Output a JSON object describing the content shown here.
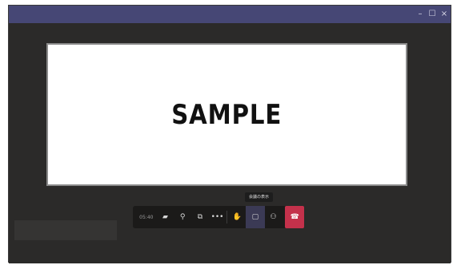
{
  "window": {
    "minimize_icon": "–",
    "maximize_icon": "☐",
    "close_icon": "×"
  },
  "stage": {
    "text": "SAMPLE"
  },
  "tooltip": {
    "text": "会議の表示"
  },
  "toolbar": {
    "timer": "05:40",
    "icons": {
      "camera": "▰",
      "mic": "⚲",
      "share": "⧉",
      "more": "•••",
      "hand": "✋",
      "chat": "▢",
      "people": "⚇",
      "hangup": "☎"
    }
  },
  "colors": {
    "titlebar": "#464775",
    "hangup": "#c4314b",
    "active": "#3b3a55"
  }
}
